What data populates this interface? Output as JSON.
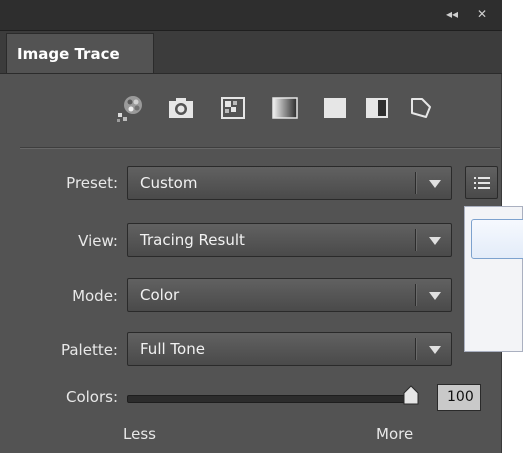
{
  "panel": {
    "tab_label": "Image Trace",
    "controls": {
      "collapse": "◂◂",
      "close": "✕"
    }
  },
  "toolbar": {
    "icons": [
      "auto-color-icon",
      "high-color-photo-icon",
      "low-color-icon",
      "grayscale-icon",
      "black-and-white-icon",
      "outline-icon"
    ]
  },
  "fields": {
    "preset": {
      "label": "Preset:",
      "value": "Custom"
    },
    "view": {
      "label": "View:",
      "value": "Tracing Result"
    },
    "mode": {
      "label": "Mode:",
      "value": "Color"
    },
    "palette": {
      "label": "Palette:",
      "value": "Full Tone"
    }
  },
  "colors": {
    "label": "Colors:",
    "value": "100",
    "slider_fraction": 1.0,
    "min_label": "Less",
    "max_label": "More"
  },
  "theme": {
    "panel_bg": "#535353",
    "titlebar_bg": "#2e2e2e",
    "text": "#e8e8e8"
  }
}
